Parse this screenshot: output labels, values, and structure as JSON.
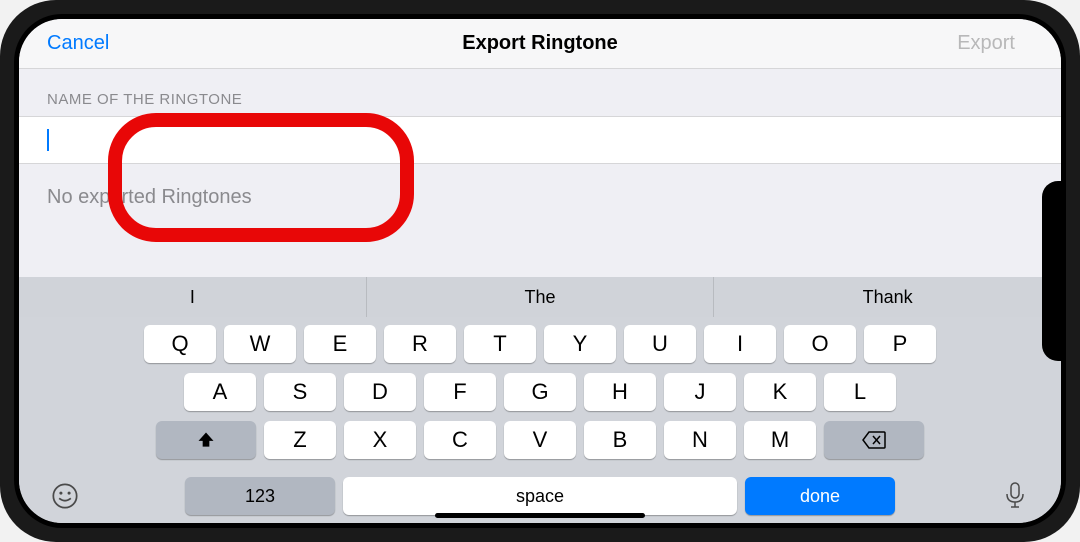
{
  "header": {
    "cancel": "Cancel",
    "title": "Export Ringtone",
    "export": "Export"
  },
  "form": {
    "section_label": "NAME OF THE RINGTONE",
    "name_value": "",
    "status": "No exported Ringtones"
  },
  "keyboard": {
    "suggestions": [
      "I",
      "The",
      "Thank"
    ],
    "row1": [
      "Q",
      "W",
      "E",
      "R",
      "T",
      "Y",
      "U",
      "I",
      "O",
      "P"
    ],
    "row2": [
      "A",
      "S",
      "D",
      "F",
      "G",
      "H",
      "J",
      "K",
      "L"
    ],
    "row3": [
      "Z",
      "X",
      "C",
      "V",
      "B",
      "N",
      "M"
    ],
    "num_label": "123",
    "space_label": "space",
    "done_label": "done"
  }
}
